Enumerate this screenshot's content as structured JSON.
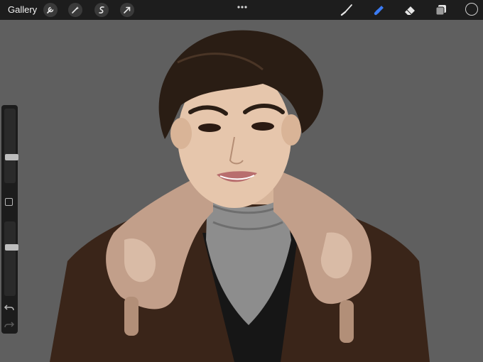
{
  "toolbar": {
    "gallery_label": "Gallery",
    "left_tools": [
      "wrench-icon",
      "magic-wand-icon",
      "selection-icon",
      "transform-arrow-icon"
    ],
    "more_icon": "more-dots-icon",
    "right_tools": [
      "brush-icon",
      "smudge-icon",
      "eraser-icon",
      "layers-icon"
    ],
    "active_tool": "smudge-icon",
    "accent_color": "#3b7cf5",
    "current_color": "#1d1d1d"
  },
  "sidebar": {
    "brush_size_level": 0.32,
    "opacity_level": 0.35,
    "modify_button_icon": "square-modify-icon",
    "undo_icon": "undo-icon",
    "redo_icon": "redo-icon"
  },
  "canvas": {
    "background_color": "#5f5f5f",
    "artwork": "digital-portrait-illustration"
  }
}
